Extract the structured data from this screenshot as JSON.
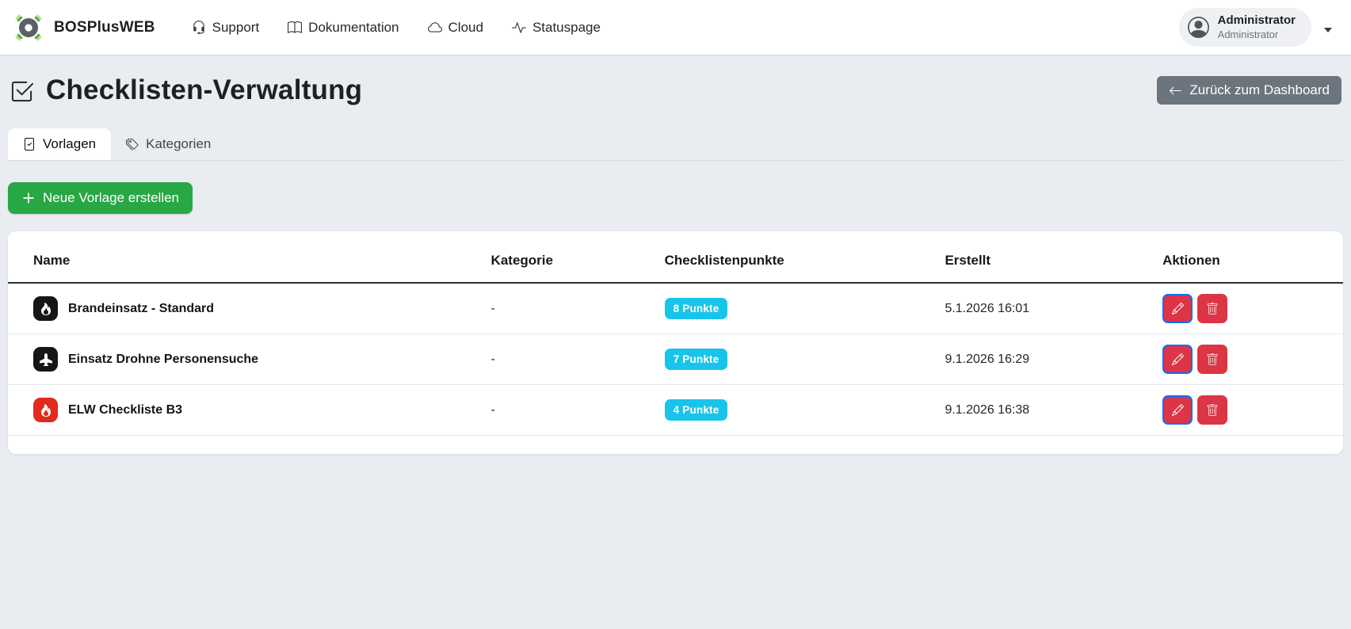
{
  "brand": "BOSPlusWEB",
  "nav": {
    "items": [
      {
        "label": "Support",
        "icon": "headset-icon"
      },
      {
        "label": "Dokumentation",
        "icon": "book-icon"
      },
      {
        "label": "Cloud",
        "icon": "cloud-icon"
      },
      {
        "label": "Statuspage",
        "icon": "activity-icon"
      }
    ]
  },
  "user": {
    "name": "Administrator",
    "role": "Administrator"
  },
  "page": {
    "title": "Checklisten-Verwaltung",
    "back_label": "Zurück zum Dashboard",
    "new_template_label": "Neue Vorlage erstellen"
  },
  "tabs": [
    {
      "label": "Vorlagen",
      "active": true
    },
    {
      "label": "Kategorien",
      "active": false
    }
  ],
  "table": {
    "columns": [
      "Name",
      "Kategorie",
      "Checklistenpunkte",
      "Erstellt",
      "Aktionen"
    ],
    "rows": [
      {
        "name": "Brandeinsatz - Standard",
        "icon": "fire-icon",
        "icon_bg": "#161616",
        "kategorie": "-",
        "punkte": "8 Punkte",
        "erstellt": "5.1.2026 16:01"
      },
      {
        "name": "Einsatz Drohne Personensuche",
        "icon": "airplane-icon",
        "icon_bg": "#161616",
        "kategorie": "-",
        "punkte": "7 Punkte",
        "erstellt": "9.1.2026 16:29"
      },
      {
        "name": "ELW Checkliste B3",
        "icon": "fire-icon",
        "icon_bg": "#e02b1d",
        "kategorie": "-",
        "punkte": "4 Punkte",
        "erstellt": "9.1.2026 16:38"
      }
    ]
  },
  "colors": {
    "success_green": "#28a745",
    "badge_cyan": "#18c4e9",
    "danger_red": "#dc3545",
    "edit_border_blue": "#0d6efd",
    "secondary_gray": "#6c757d",
    "page_background": "#e9edf1"
  }
}
